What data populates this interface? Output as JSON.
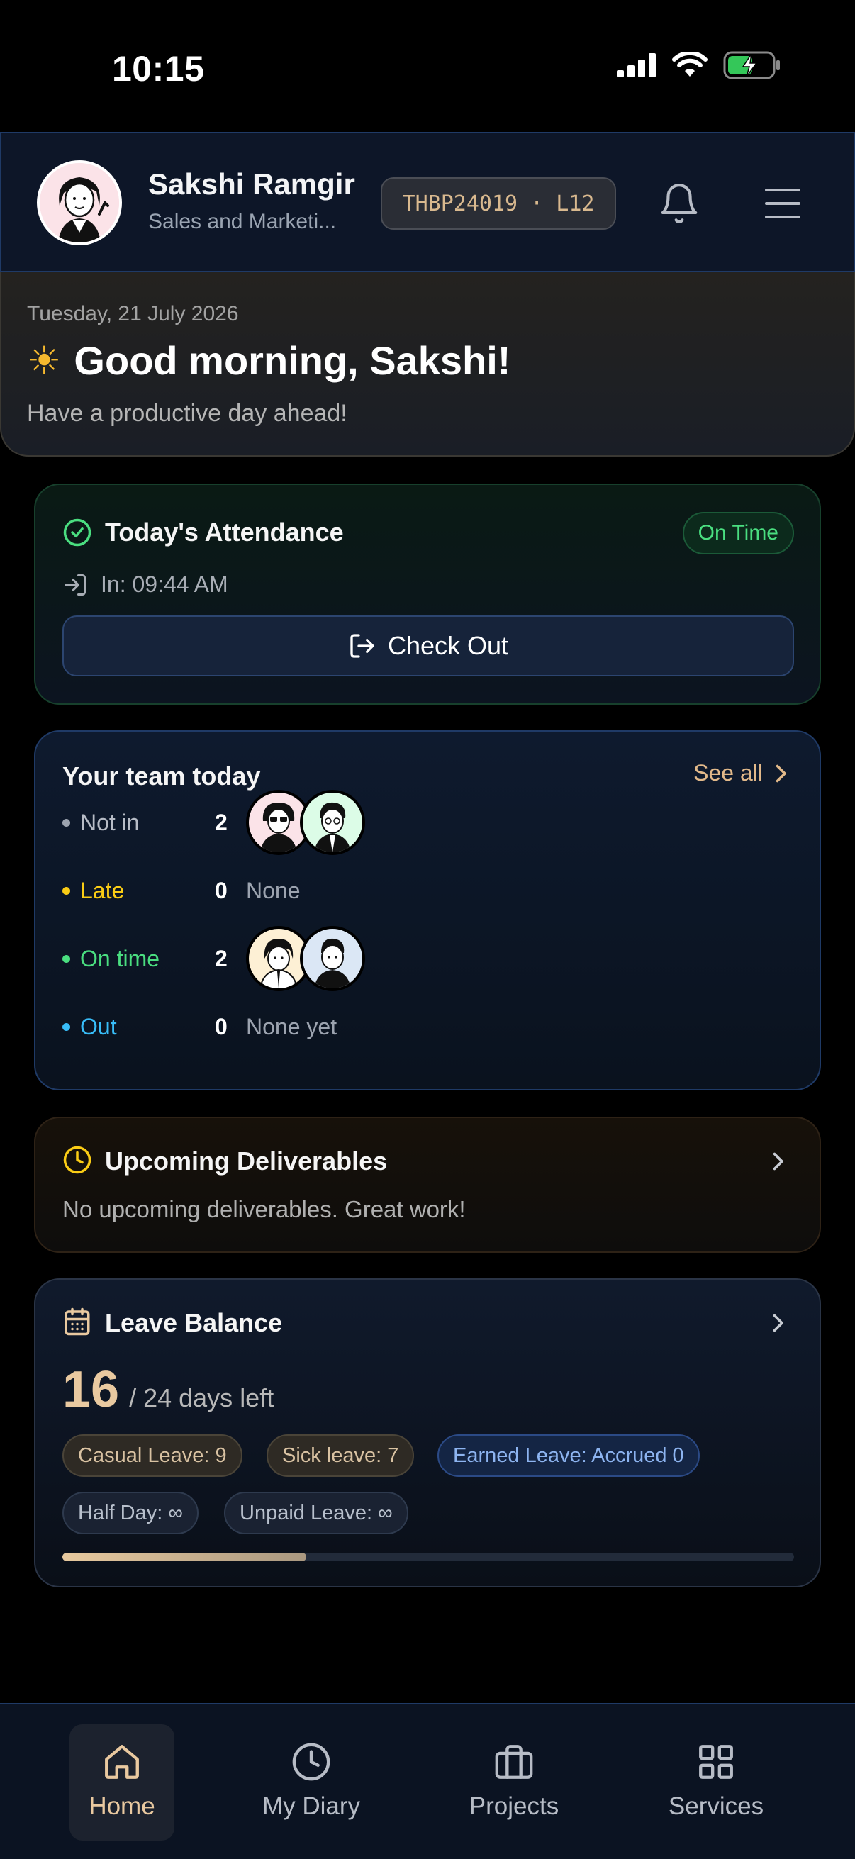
{
  "status_bar": {
    "time": "10:15"
  },
  "header": {
    "user_name": "Sakshi Ramgir",
    "department": "Sales and Marketi...",
    "employee_chip": "THBP24019 · L12"
  },
  "greeting": {
    "date": "Tuesday, 21 July 2026",
    "title": "Good morning, Sakshi!",
    "subtitle": "Have a productive day ahead!"
  },
  "attendance": {
    "title": "Today's Attendance",
    "status": "On Time",
    "check_in": "In: 09:44 AM",
    "checkout_label": "Check Out"
  },
  "team": {
    "title": "Your team today",
    "see_all": "See all",
    "rows": [
      {
        "label": "Not in",
        "count": "2",
        "color": "#9ca3af",
        "none": ""
      },
      {
        "label": "Late",
        "count": "0",
        "color": "#facc15",
        "none": "None"
      },
      {
        "label": "On time",
        "count": "2",
        "color": "#4ade80",
        "none": ""
      },
      {
        "label": "Out",
        "count": "0",
        "color": "#38bdf8",
        "none": "None yet"
      }
    ]
  },
  "deliverables": {
    "title": "Upcoming Deliverables",
    "empty_text": "No upcoming deliverables. Great work!"
  },
  "leave": {
    "title": "Leave Balance",
    "remaining": "16",
    "of_total": "/ 24 days left",
    "progress_fraction": 0.333,
    "chips": [
      "Casual Leave: 9",
      "Sick leave: 7",
      "Earned Leave: Accrued 0",
      "Half Day: ∞",
      "Unpaid Leave: ∞"
    ]
  },
  "nav": {
    "items": [
      "Home",
      "My Diary",
      "Projects",
      "Services"
    ],
    "active": "Home"
  },
  "colors": {
    "accent_gold": "#e9c9a0",
    "success_green": "#4ade80",
    "header_border": "#1f3a66"
  }
}
